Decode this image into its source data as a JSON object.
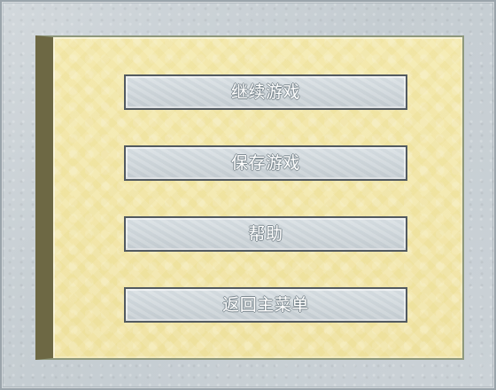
{
  "menu": {
    "buttons": [
      {
        "label": "继续游戏"
      },
      {
        "label": "保存游戏"
      },
      {
        "label": "帮助"
      },
      {
        "label": "返回主菜单"
      }
    ]
  },
  "colors": {
    "outer_frame": "#c9d1d6",
    "panel_background": "#efe3a5",
    "panel_left_bar": "#6d6844",
    "button_fill": "#d1d8dc",
    "button_border": "#525a60",
    "button_text": "#ffffff"
  }
}
